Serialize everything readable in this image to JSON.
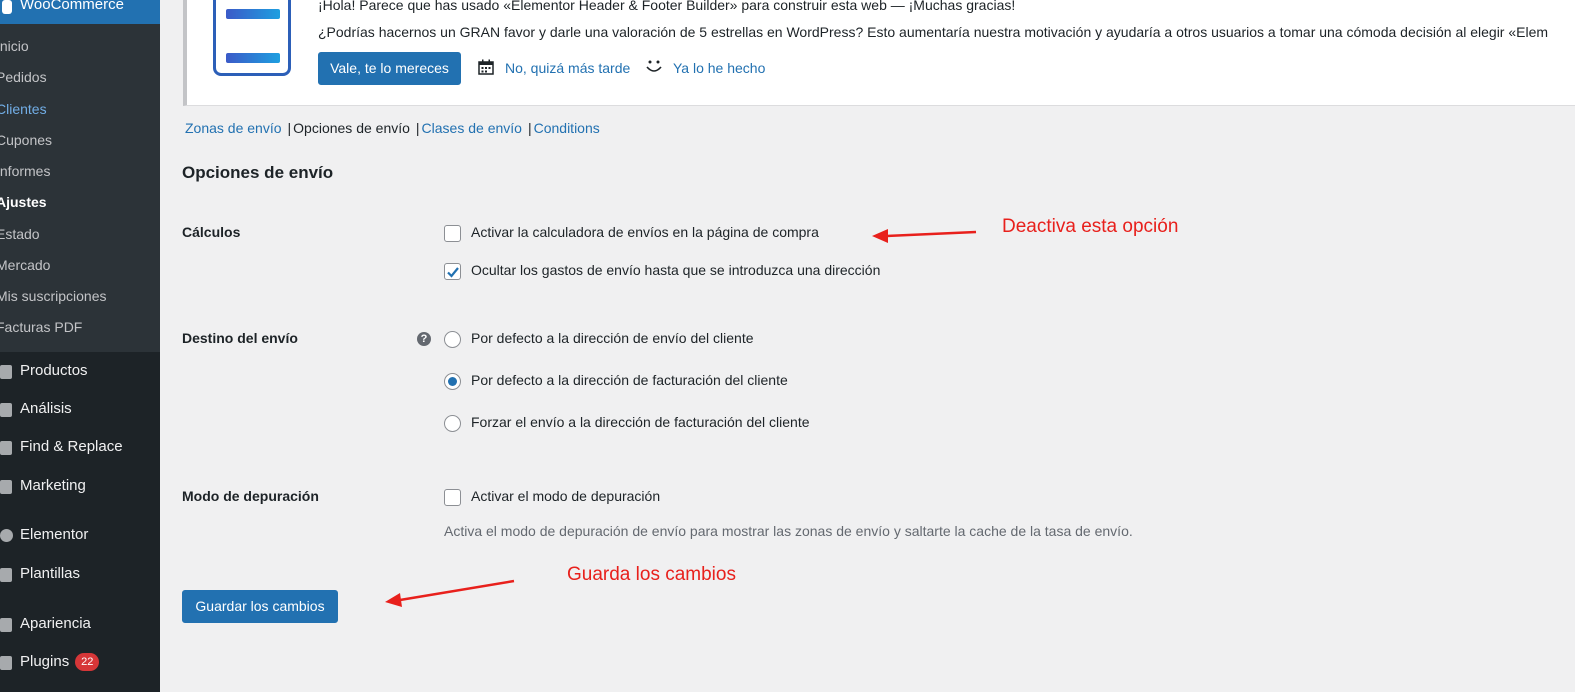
{
  "sidebar": {
    "woocommerce_label": "WooCommerce",
    "submenu": [
      {
        "label": "Inicio"
      },
      {
        "label": "Pedidos"
      },
      {
        "label": "Clientes"
      },
      {
        "label": "Cupones"
      },
      {
        "label": "Informes"
      },
      {
        "label": "Ajustes"
      },
      {
        "label": "Estado"
      },
      {
        "label": "Mercado"
      },
      {
        "label": "Mis suscripciones"
      },
      {
        "label": "Facturas PDF"
      }
    ],
    "menu": [
      {
        "label": "Productos",
        "icon": "archive-icon"
      },
      {
        "label": "Análisis",
        "icon": "bar-chart-icon"
      },
      {
        "label": "Find & Replace",
        "icon": "replace-icon"
      },
      {
        "label": "Marketing",
        "icon": "megaphone-icon"
      },
      {
        "label": "Elementor",
        "icon": "elementor-icon"
      },
      {
        "label": "Plantillas",
        "icon": "folder-icon"
      },
      {
        "label": "Apariencia",
        "icon": "brush-icon"
      },
      {
        "label": "Plugins",
        "icon": "plug-icon",
        "badge": "22"
      }
    ]
  },
  "notice": {
    "line1": "¡Hola! Parece que has usado «Elementor Header & Footer Builder» para construir esta web — ¡Muchas gracias!",
    "line2": "¿Podrías hacernos un GRAN favor y darle una valoración de 5 estrellas en WordPress? Esto aumentaría nuestra motivación y ayudaría a otros usuarios a tomar una cómoda decisión al elegir «Elem",
    "rate_button": "Vale, te lo mereces",
    "later_link": "No, quizá más tarde",
    "done_link": "Ya lo he hecho"
  },
  "subnav": {
    "items": [
      {
        "label": "Zonas de envío"
      },
      {
        "label": "Opciones de envío"
      },
      {
        "label": "Clases de envío"
      },
      {
        "label": "Conditions"
      }
    ]
  },
  "page": {
    "title": "Opciones de envío"
  },
  "settings": {
    "calculos": {
      "label": "Cálculos",
      "options": [
        {
          "label": "Activar la calculadora de envíos en la página de compra",
          "checked": false
        },
        {
          "label": "Ocultar los gastos de envío hasta que se introduzca una dirección",
          "checked": true
        }
      ]
    },
    "destino": {
      "label": "Destino del envío",
      "options": [
        {
          "label": "Por defecto a la dirección de envío del cliente",
          "selected": false
        },
        {
          "label": "Por defecto a la dirección de facturación del cliente",
          "selected": true
        },
        {
          "label": "Forzar el envío a la dirección de facturación del cliente",
          "selected": false
        }
      ]
    },
    "depuracion": {
      "label": "Modo de depuración",
      "option": "Activar el modo de depuración",
      "description": "Activa el modo de depuración de envío para mostrar las zonas de envío y saltarte la cache de la tasa de envío."
    }
  },
  "save_button": "Guardar los cambios",
  "annotations": {
    "deactivate": "Deactiva esta opción",
    "save": "Guarda los cambios"
  },
  "colors": {
    "primary": "#2271b1",
    "sidebar": "#1d2327",
    "annotation": "#e8201c"
  }
}
